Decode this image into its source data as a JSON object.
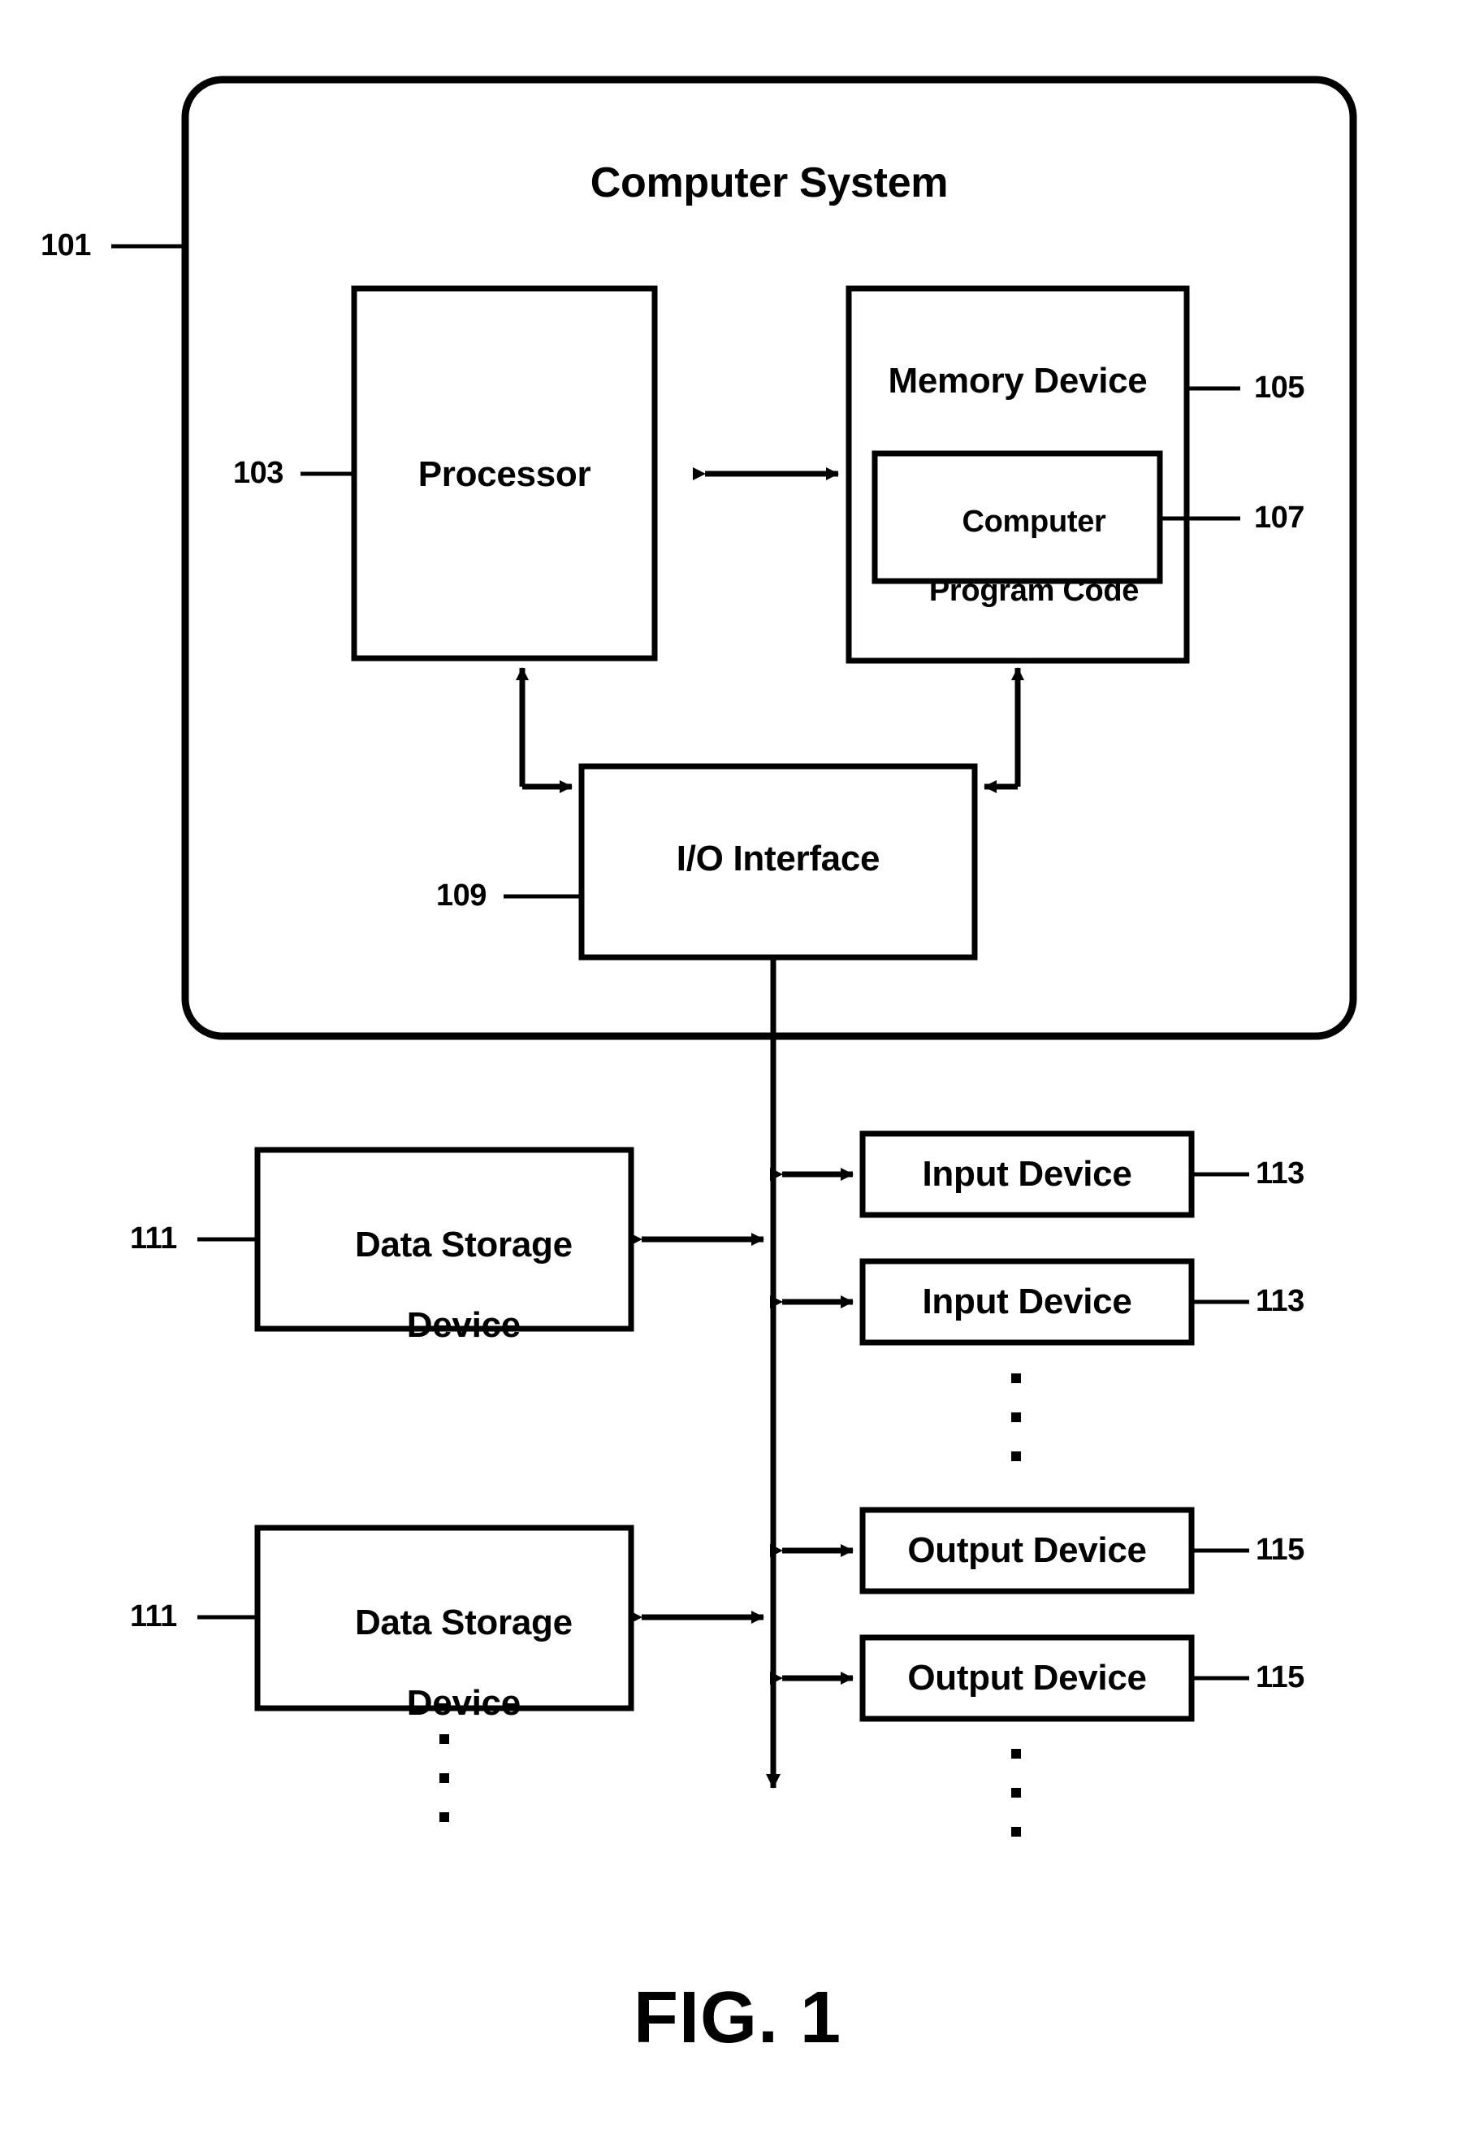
{
  "figure": {
    "caption": "FIG. 1",
    "system": {
      "title": "Computer System",
      "ref": "101"
    },
    "blocks": {
      "processor": {
        "label": "Processor",
        "ref": "103"
      },
      "memory_device": {
        "label": "Memory Device",
        "ref": "105"
      },
      "computer_program_code": {
        "label_line1": "Computer",
        "label_line2": "Program Code",
        "ref": "107"
      },
      "io_interface": {
        "label": "I/O Interface",
        "ref": "109"
      },
      "data_storage_device_1": {
        "label_line1": "Data Storage",
        "label_line2": "Device",
        "ref": "111"
      },
      "data_storage_device_2": {
        "label_line1": "Data Storage",
        "label_line2": "Device",
        "ref": "111"
      },
      "input_device_1": {
        "label": "Input Device",
        "ref": "113"
      },
      "input_device_2": {
        "label": "Input Device",
        "ref": "113"
      },
      "output_device_1": {
        "label": "Output Device",
        "ref": "115"
      },
      "output_device_2": {
        "label": "Output Device",
        "ref": "115"
      }
    },
    "ellipses": {
      "input_column": "⋮",
      "output_column": "⋮",
      "storage_column": "⋮"
    },
    "colors": {
      "stroke": "#000000",
      "background": "#ffffff",
      "text": "#000000"
    }
  }
}
